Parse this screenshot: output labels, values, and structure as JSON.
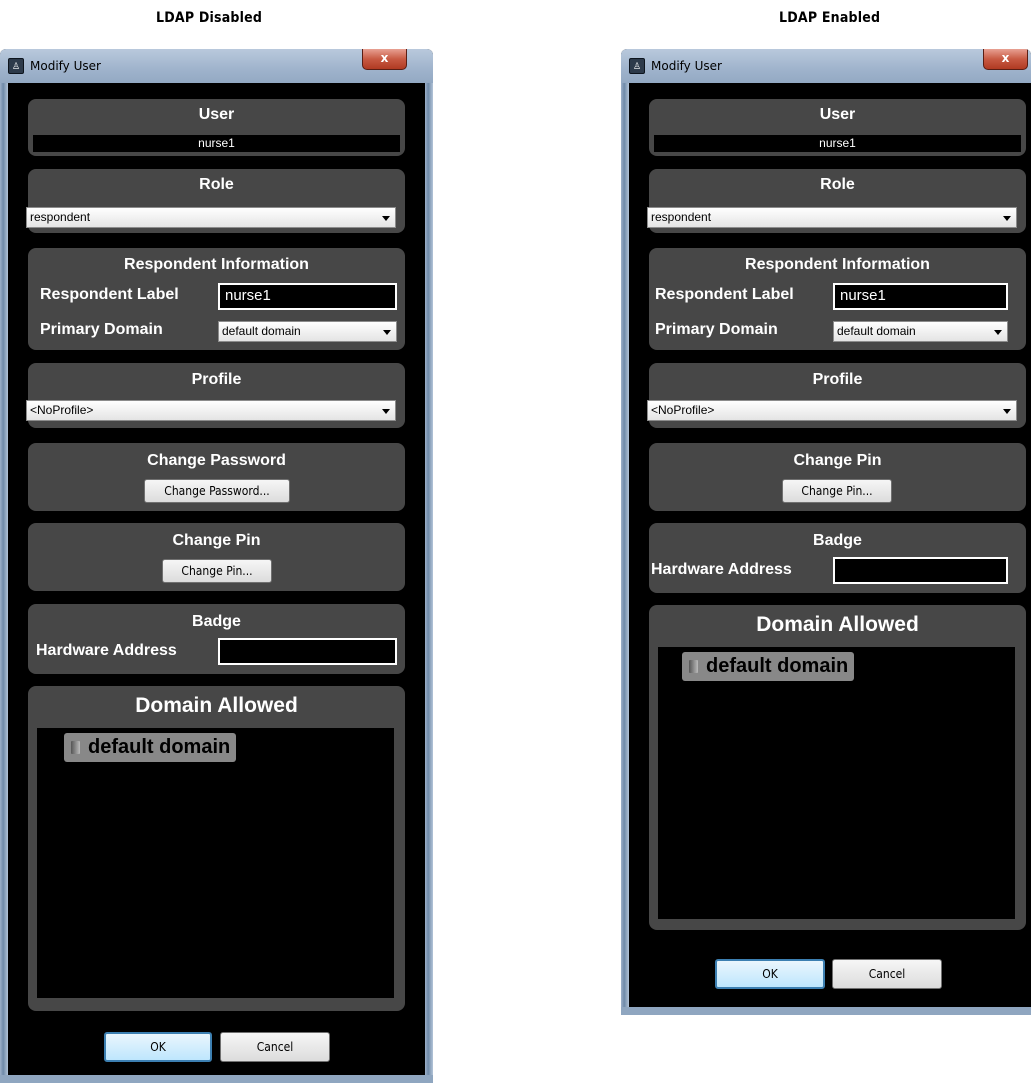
{
  "captions": {
    "left": "LDAP Disabled",
    "right": "LDAP Enabled"
  },
  "dialog": {
    "title": "Modify User",
    "close_label": "x",
    "user": {
      "heading": "User",
      "value": "nurse1"
    },
    "role": {
      "heading": "Role",
      "selected": "respondent"
    },
    "respondent": {
      "heading": "Respondent Information",
      "label_caption": "Respondent Label",
      "label_value": "nurse1",
      "domain_caption": "Primary Domain",
      "domain_selected": "default domain"
    },
    "profile": {
      "heading": "Profile",
      "selected": "<NoProfile>"
    },
    "password": {
      "heading": "Change Password",
      "button": "Change Password..."
    },
    "pin": {
      "heading": "Change Pin",
      "button": "Change Pin..."
    },
    "badge": {
      "heading": "Badge",
      "hw_caption": "Hardware Address",
      "hw_value": ""
    },
    "domains": {
      "heading": "Domain Allowed",
      "items": [
        "default domain"
      ]
    },
    "ok_label": "OK",
    "cancel_label": "Cancel"
  },
  "colors": {
    "panel": "#474747",
    "background": "#000000",
    "title_bar": "#9fb3cc",
    "close_button": "#c85a43"
  }
}
